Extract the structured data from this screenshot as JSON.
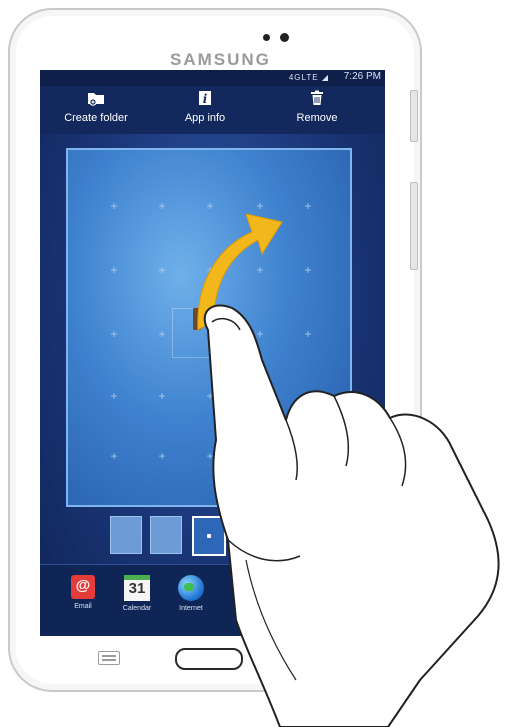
{
  "device": {
    "brand": "SAMSUNG"
  },
  "status_bar": {
    "network": "4G",
    "network_sub": "LTE",
    "time": "7:26 PM"
  },
  "action_bar": {
    "create_folder": "Create folder",
    "app_info": "App info",
    "remove": "Remove"
  },
  "dock": {
    "apps": [
      {
        "label": "Email",
        "icon": "email-icon"
      },
      {
        "label": "Calendar",
        "icon": "calendar-icon",
        "date": "31"
      },
      {
        "label": "Internet",
        "icon": "globe-icon"
      }
    ]
  },
  "page_indicator": {
    "page_count": 4,
    "current_page": 3
  },
  "gesture": {
    "type": "drag",
    "direction": "up-right",
    "arrow_color": "#f2b71a"
  },
  "colors": {
    "screen": "#1a3576",
    "panel": "#3f82cf",
    "arrow": "#f2b71a"
  }
}
